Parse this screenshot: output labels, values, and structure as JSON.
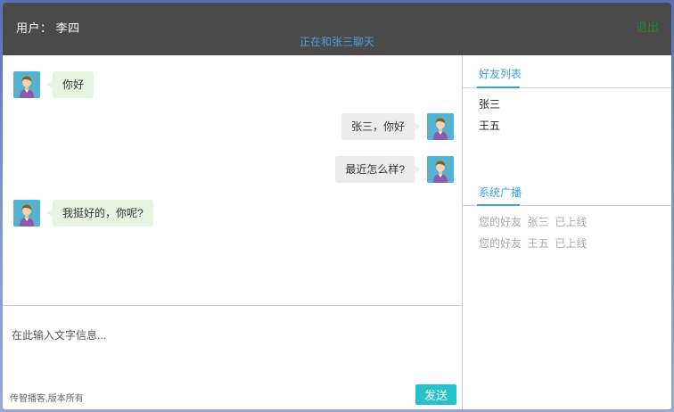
{
  "header": {
    "user_label": "用户： 李四",
    "status": "正在和张三聊天",
    "logout_label": "退出"
  },
  "messages": [
    {
      "side": "left",
      "text": "你好"
    },
    {
      "side": "right",
      "text": "张三，你好"
    },
    {
      "side": "right",
      "text": "最近怎么样?"
    },
    {
      "side": "left",
      "text": "我挺好的，你呢?"
    }
  ],
  "composer": {
    "placeholder": "在此输入文字信息...",
    "value": "",
    "copyright": "传智播客,版本所有",
    "send_label": "发送"
  },
  "sidebar": {
    "friends_title": "好友列表",
    "friends": [
      "张三",
      "王五"
    ],
    "broadcast_title": "系统广播",
    "broadcasts": [
      "您的好友  张三  已上线",
      "您的好友  王五  已上线"
    ]
  },
  "colors": {
    "header_bg": "#4a4a4a",
    "accent_blue": "#3aa5d8",
    "logout_green": "#1f8a2a",
    "send_button": "#27c1c9",
    "left_bubble": "#e6f4e1",
    "right_bubble": "#ececec"
  }
}
